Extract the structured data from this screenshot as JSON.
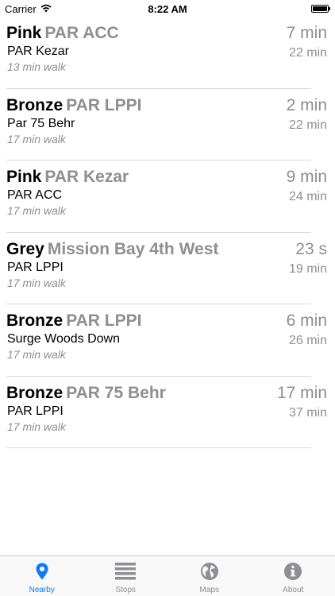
{
  "status_bar": {
    "carrier": "Carrier",
    "time": "8:22 AM",
    "battery_level": 1.0
  },
  "rows": [
    {
      "color": "Pink",
      "route": "PAR ACC",
      "direction": "PAR Kezar",
      "walk": "13 min walk",
      "eta": "7 min",
      "next": "22 min"
    },
    {
      "color": "Bronze",
      "route": "PAR LPPI",
      "direction": "Par 75 Behr",
      "walk": "17 min walk",
      "eta": "2 min",
      "next": "22 min"
    },
    {
      "color": "Pink",
      "route": "PAR Kezar",
      "direction": "PAR ACC",
      "walk": "17 min walk",
      "eta": "9 min",
      "next": "24 min"
    },
    {
      "color": "Grey",
      "route": "Mission Bay 4th West",
      "direction": "PAR LPPI",
      "walk": "17 min walk",
      "eta": "23 s",
      "next": "19 min"
    },
    {
      "color": "Bronze",
      "route": "PAR LPPI",
      "direction": "Surge Woods Down",
      "walk": "17 min walk",
      "eta": "6 min",
      "next": "26 min"
    },
    {
      "color": "Bronze",
      "route": "PAR 75 Behr",
      "direction": "PAR LPPI",
      "walk": "17 min walk",
      "eta": "17 min",
      "next": "37 min"
    }
  ],
  "tabs": [
    {
      "label": "Nearby",
      "icon": "location-pin-icon",
      "active": true
    },
    {
      "label": "Stops",
      "icon": "list-icon",
      "active": false
    },
    {
      "label": "Maps",
      "icon": "globe-icon",
      "active": false
    },
    {
      "label": "About",
      "icon": "info-icon",
      "active": false
    }
  ],
  "colors": {
    "accent": "#0a7aff",
    "secondary_text": "#8e8e93",
    "tab_inactive": "#8e8e93"
  }
}
